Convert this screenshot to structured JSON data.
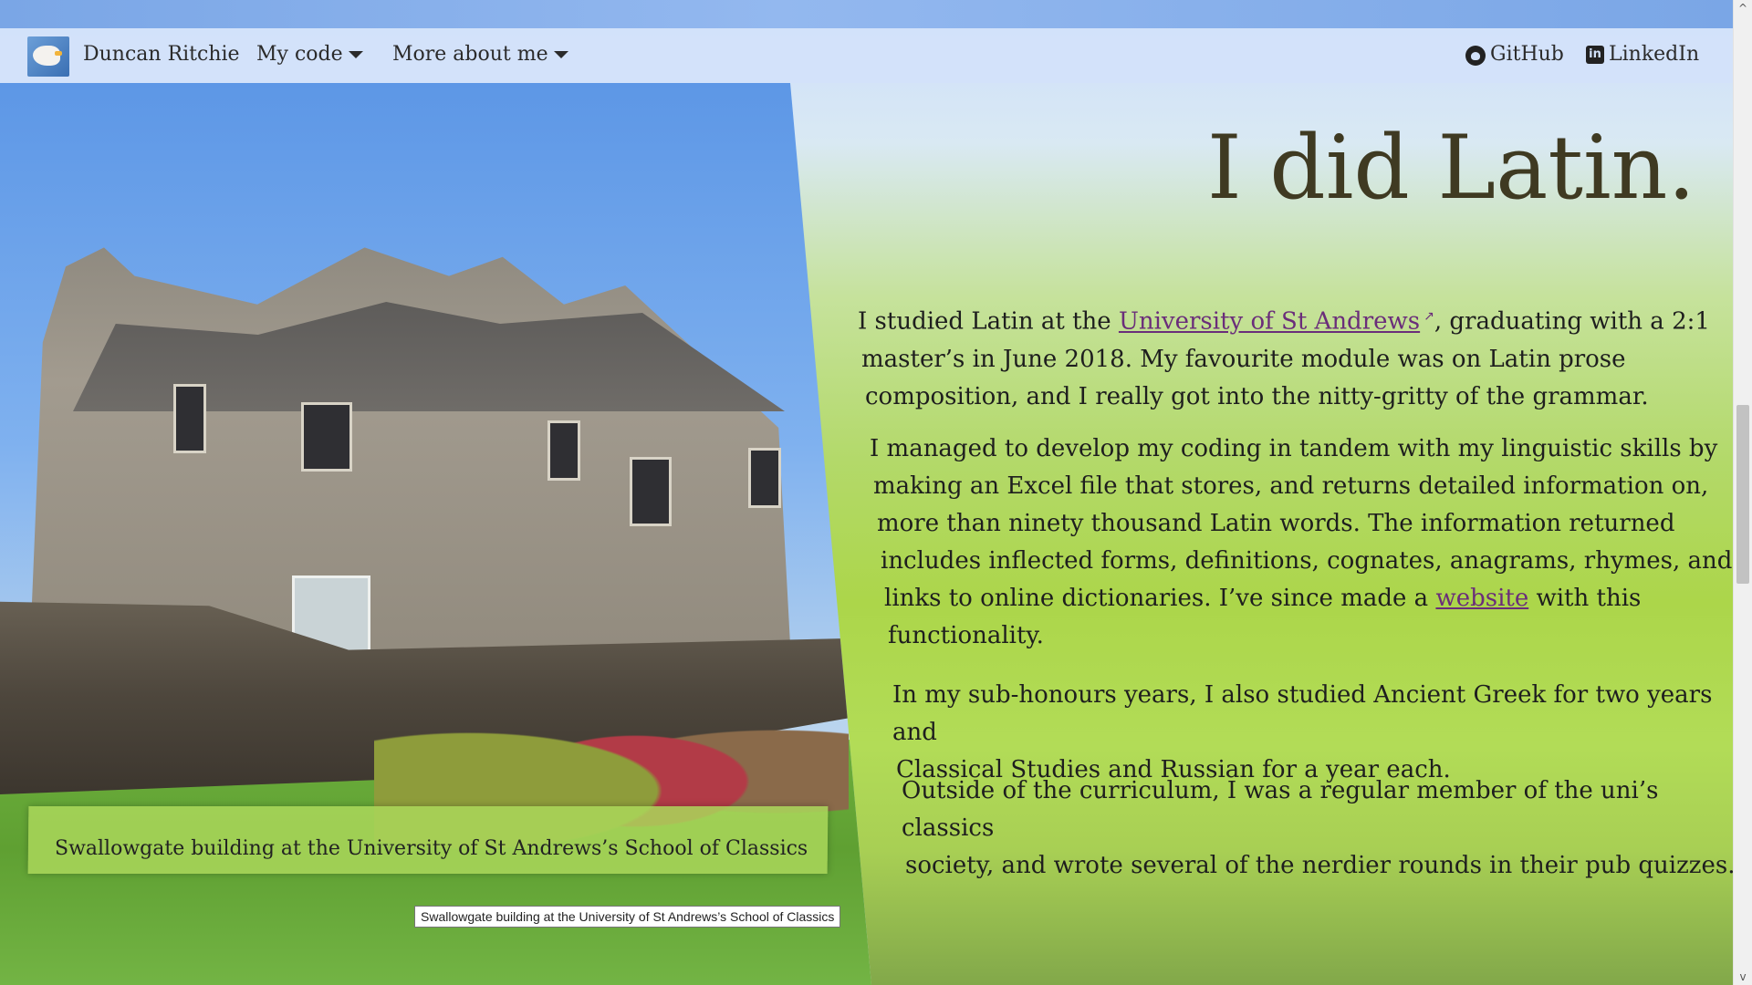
{
  "navbar": {
    "brand_name": "Duncan Ritchie",
    "my_code_label": "My code",
    "more_about_label": "More about me",
    "github_label": "GitHub",
    "linkedin_label": "LinkedIn",
    "github_icon": "github-icon",
    "linkedin_icon": "linkedin-icon",
    "linkedin_glyph": "in"
  },
  "hero": {
    "caption": "Swallowgate building at the University of St Andrews’s School of Classics",
    "tooltip": "Swallowgate building at the University of St Andrews’s School of Classics"
  },
  "content": {
    "title": "I did Latin.",
    "p1_before": "I studied Latin at the ",
    "p1_link": "University of St Andrews",
    "p1_ext_icon": "↗",
    "p1_after1": ", graduating with a 2:1",
    "p1_line2": "master’s in June 2018. My favourite module was on Latin prose",
    "p1_line3": "composition, and I really got into the nitty-gritty of the grammar.",
    "p2_line1": "I managed to develop my coding in tandem with my linguistic skills by",
    "p2_line2": "making an Excel file that stores, and returns detailed information on,",
    "p2_line3": "more than ninety thousand Latin words. The information returned",
    "p2_line4": "includes inflected forms, definitions, cognates, anagrams, rhymes, and",
    "p2_line5_before": "links to online dictionaries. I’ve since made a ",
    "p2_link": "website",
    "p2_line5_after": " with this",
    "p2_line6": "functionality.",
    "p3_line1": "In my sub-honours years, I also studied Ancient Greek for two years and",
    "p3_line2": "Classical Studies and Russian for a year each.",
    "p4_line1": "Outside of the curriculum, I was a regular member of the uni’s classics",
    "p4_line2": "society, and wrote several of the nerdier rounds in their pub quizzes."
  },
  "scrollbar": {
    "up_arrow": "^",
    "down_arrow": "v"
  },
  "colors": {
    "title": "#3f3a22",
    "link": "#6a2d7a"
  }
}
